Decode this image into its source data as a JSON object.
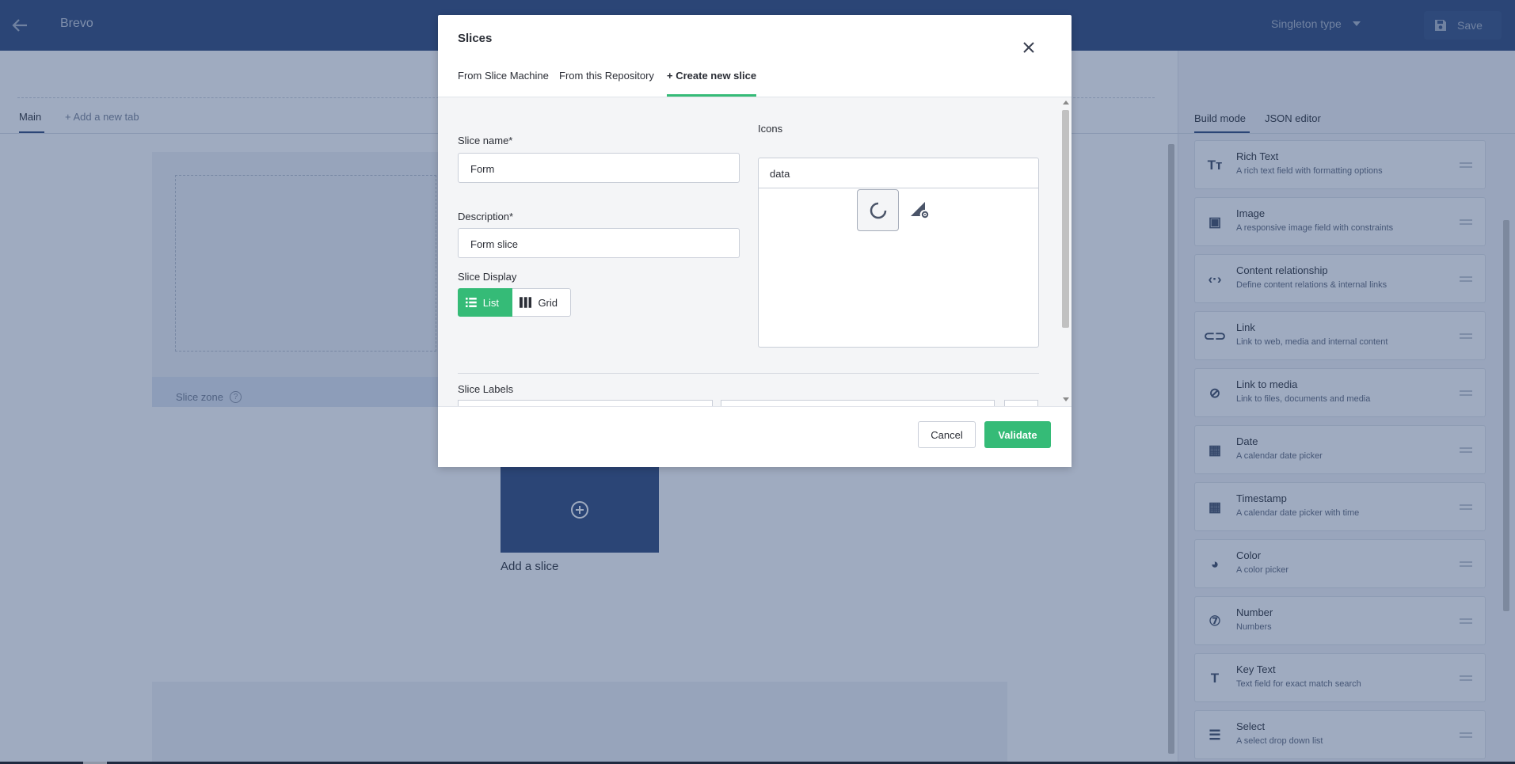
{
  "app": {
    "title": "Brevo",
    "type_selector": "Singleton type",
    "save_label": "Save"
  },
  "content_tabs": {
    "main": "Main",
    "add_tab": "+ Add a new tab"
  },
  "slice_zone": {
    "label": "Slice zone",
    "help_glyph": "?",
    "add_slice_label": "Add a slice"
  },
  "right_panel": {
    "tabs": [
      "Build mode",
      "JSON editor"
    ],
    "active_tab": "Build mode",
    "fields": [
      {
        "name": "Rich Text",
        "description": "A rich text field with formatting options",
        "icon": "rich-text-icon",
        "glyph": "Tт"
      },
      {
        "name": "Image",
        "description": "A responsive image field with constraints",
        "icon": "image-icon",
        "glyph": "▣"
      },
      {
        "name": "Content relationship",
        "description": "Define content relations & internal links",
        "icon": "relationship-icon",
        "glyph": "‹·›"
      },
      {
        "name": "Link",
        "description": "Link to web, media and internal content",
        "icon": "link-icon",
        "glyph": "⊂⊃"
      },
      {
        "name": "Link to media",
        "description": "Link to files, documents and media",
        "icon": "attachment-icon",
        "glyph": "⊘"
      },
      {
        "name": "Date",
        "description": "A calendar date picker",
        "icon": "calendar-icon",
        "glyph": "▦"
      },
      {
        "name": "Timestamp",
        "description": "A calendar date picker with time",
        "icon": "timestamp-icon",
        "glyph": "▦"
      },
      {
        "name": "Color",
        "description": "A color picker",
        "icon": "palette-icon",
        "glyph": "◕"
      },
      {
        "name": "Number",
        "description": "Numbers",
        "icon": "number-icon",
        "glyph": "⑦"
      },
      {
        "name": "Key Text",
        "description": "Text field for exact match search",
        "icon": "key-text-icon",
        "glyph": "T"
      },
      {
        "name": "Select",
        "description": "A select drop down list",
        "icon": "select-icon",
        "glyph": "☰"
      }
    ]
  },
  "modal": {
    "title": "Slices",
    "tabs": [
      "From Slice Machine",
      "From this Repository",
      "+ Create new slice"
    ],
    "active_tab": "+ Create new slice",
    "slice_name_label": "Slice name*",
    "slice_name_value": "Form",
    "description_label": "Description*",
    "description_value": "Form slice",
    "display_label": "Slice Display",
    "display_options": [
      "List",
      "Grid"
    ],
    "display_selected": "List",
    "icons_label": "Icons",
    "icons_search_value": "data",
    "icon_options": [
      "loading-circle-icon",
      "signal-settings-icon"
    ],
    "labels_label": "Slice Labels",
    "cancel_label": "Cancel",
    "validate_label": "Validate"
  },
  "colors": {
    "accent": "#35bb77",
    "topbar": "#2c4679",
    "overlay": "rgba(43, 68, 115, 0.45)"
  }
}
